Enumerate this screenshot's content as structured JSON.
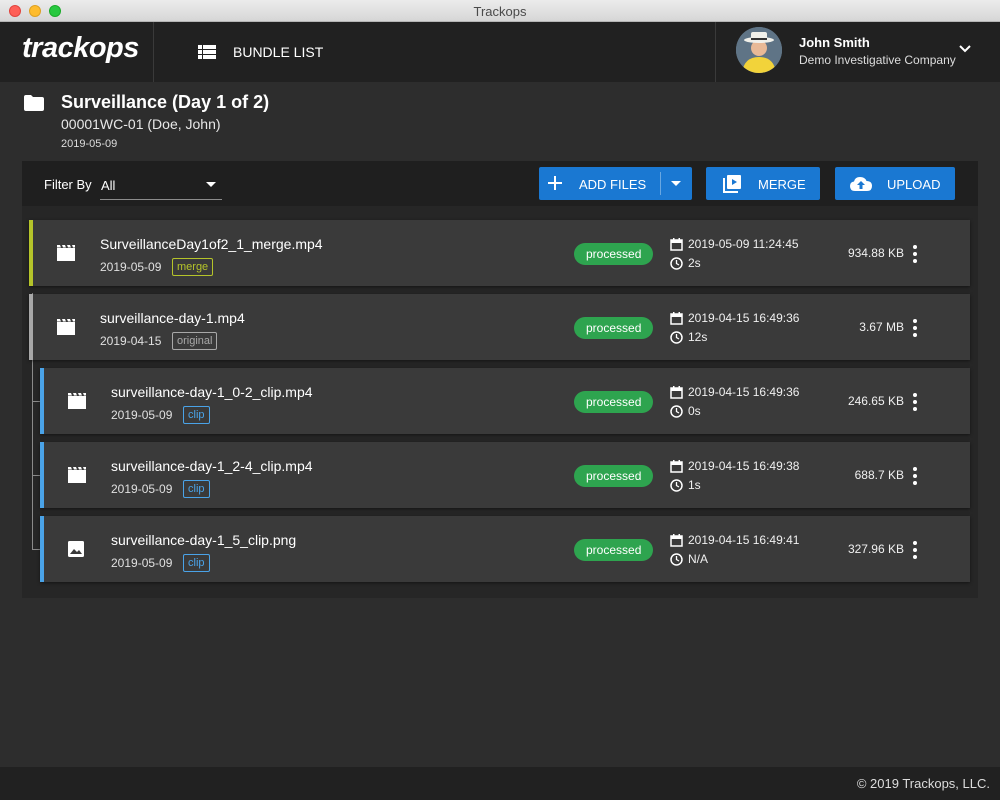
{
  "window": {
    "title": "Trackops"
  },
  "appbar": {
    "logo": "trackops",
    "nav_label": "BUNDLE LIST",
    "user_name": "John Smith",
    "user_company": "Demo Investigative Company"
  },
  "bundle": {
    "title": "Surveillance (Day 1 of 2)",
    "subtitle": "00001WC-01 (Doe, John)",
    "date": "2019-05-09"
  },
  "toolbar": {
    "filter_label": "Filter By",
    "filter_value": "All",
    "add_files_label": "ADD FILES",
    "merge_label": "MERGE",
    "upload_label": "UPLOAD"
  },
  "colors": {
    "merge": "#b5c42a",
    "original": "#a8a8a8",
    "clip": "#4aa3e8",
    "processed": "#2ea44f",
    "primary_button": "#1a78d2"
  },
  "files": [
    {
      "name": "SurveillanceDay1of2_1_merge.mp4",
      "date": "2019-05-09",
      "tag": "merge",
      "status": "processed",
      "timestamp": "2019-05-09 11:24:45",
      "duration": "2s",
      "size": "934.88 KB",
      "icon": "movie-icon"
    },
    {
      "name": "surveillance-day-1.mp4",
      "date": "2019-04-15",
      "tag": "original",
      "status": "processed",
      "timestamp": "2019-04-15 16:49:36",
      "duration": "12s",
      "size": "3.67 MB",
      "icon": "movie-icon"
    },
    {
      "name": "surveillance-day-1_0-2_clip.mp4",
      "date": "2019-05-09",
      "tag": "clip",
      "status": "processed",
      "timestamp": "2019-04-15 16:49:36",
      "duration": "0s",
      "size": "246.65 KB",
      "icon": "movie-icon"
    },
    {
      "name": "surveillance-day-1_2-4_clip.mp4",
      "date": "2019-05-09",
      "tag": "clip",
      "status": "processed",
      "timestamp": "2019-04-15 16:49:38",
      "duration": "1s",
      "size": "688.7 KB",
      "icon": "movie-icon"
    },
    {
      "name": "surveillance-day-1_5_clip.png",
      "date": "2019-05-09",
      "tag": "clip",
      "status": "processed",
      "timestamp": "2019-04-15 16:49:41",
      "duration": "N/A",
      "size": "327.96 KB",
      "icon": "image-icon"
    }
  ],
  "footer": {
    "copyright": "© 2019 Trackops, LLC."
  }
}
